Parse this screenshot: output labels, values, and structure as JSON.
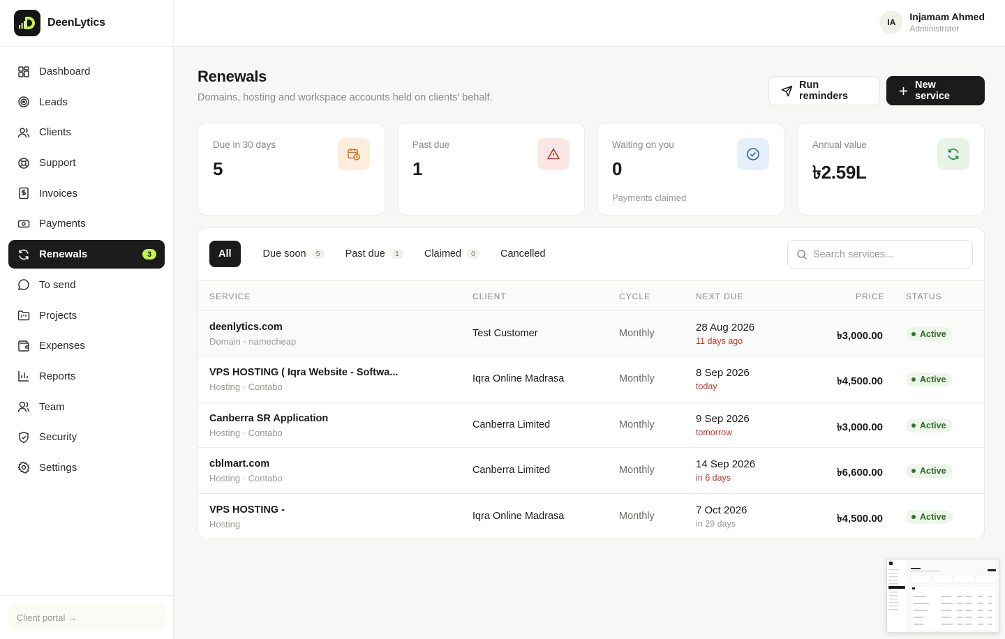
{
  "brand": {
    "name": "DeenLytics"
  },
  "sidebar": {
    "items": [
      {
        "label": "Dashboard",
        "icon": "dashboard-icon"
      },
      {
        "label": "Leads",
        "icon": "target-icon"
      },
      {
        "label": "Clients",
        "icon": "users-icon"
      },
      {
        "label": "Support",
        "icon": "lifebuoy-icon"
      },
      {
        "label": "Invoices",
        "icon": "invoice-icon"
      },
      {
        "label": "Payments",
        "icon": "banknote-icon"
      },
      {
        "label": "Renewals",
        "icon": "refresh-icon",
        "badge": "3",
        "active": true
      },
      {
        "label": "To send",
        "icon": "message-icon"
      },
      {
        "label": "Projects",
        "icon": "folder-icon"
      },
      {
        "label": "Expenses",
        "icon": "wallet-icon"
      },
      {
        "label": "Reports",
        "icon": "bar-chart-icon"
      },
      {
        "label": "Team",
        "icon": "team-icon"
      },
      {
        "label": "Security",
        "icon": "shield-icon"
      },
      {
        "label": "Settings",
        "icon": "gear-icon"
      }
    ],
    "footer_label": "Client portal →"
  },
  "user": {
    "initials": "IA",
    "name": "Injamam Ahmed",
    "role": "Administrator"
  },
  "page": {
    "title": "Renewals",
    "subtitle": "Domains, hosting and workspace accounts held on clients' behalf.",
    "run_reminders": "Run reminders",
    "new_service": "New service"
  },
  "stats": [
    {
      "label": "Due in 30 days",
      "value": "5",
      "sub": "",
      "icon": "calendar-clock-icon",
      "color": "#fbeedd"
    },
    {
      "label": "Past due",
      "value": "1",
      "sub": "",
      "icon": "warning-icon",
      "color": "#fbe6e6"
    },
    {
      "label": "Waiting on you",
      "value": "0",
      "sub": "Payments claimed",
      "icon": "check-circle-icon",
      "color": "#e6f0fa"
    },
    {
      "label": "Annual value",
      "value": "৳2.59L",
      "sub": "",
      "icon": "refresh-icon",
      "color": "#e8f4ea"
    }
  ],
  "tabs": [
    {
      "label": "All",
      "count": ""
    },
    {
      "label": "Due soon",
      "count": "5"
    },
    {
      "label": "Past due",
      "count": "1"
    },
    {
      "label": "Claimed",
      "count": "0"
    },
    {
      "label": "Cancelled",
      "count": ""
    }
  ],
  "search": {
    "placeholder": "Search services..."
  },
  "table": {
    "headers": {
      "service": "SERVICE",
      "client": "CLIENT",
      "cycle": "CYCLE",
      "next_due": "NEXT DUE",
      "price": "PRICE",
      "status": "STATUS"
    },
    "rows": [
      {
        "service": "deenlytics.com",
        "detail": "Domain · namecheap",
        "client": "Test Customer",
        "cycle": "Monthly",
        "date": "28 Aug 2026",
        "relative": "11 days ago",
        "rel_tone": "red",
        "price": "৳3,000.00",
        "status": "Active"
      },
      {
        "service": "VPS HOSTING ( Iqra Website - Softwa...",
        "detail": "Hosting · Contabo",
        "client": "Iqra Online Madrasa",
        "cycle": "Monthly",
        "date": "8 Sep 2026",
        "relative": "today",
        "rel_tone": "red",
        "price": "৳4,500.00",
        "status": "Active"
      },
      {
        "service": "Canberra SR Application",
        "detail": "Hosting · Contabo",
        "client": "Canberra Limited",
        "cycle": "Monthly",
        "date": "9 Sep 2026",
        "relative": "tomorrow",
        "rel_tone": "red",
        "price": "৳3,000.00",
        "status": "Active"
      },
      {
        "service": "cblmart.com",
        "detail": "Hosting · Contabo",
        "client": "Canberra Limited",
        "cycle": "Monthly",
        "date": "14 Sep 2026",
        "relative": "in 6 days",
        "rel_tone": "red",
        "price": "৳6,600.00",
        "status": "Active"
      },
      {
        "service": "VPS HOSTING -",
        "detail": "Hosting",
        "client": "Iqra Online Madrasa",
        "cycle": "Monthly",
        "date": "7 Oct 2026",
        "relative": "in 29 days",
        "rel_tone": "grey",
        "price": "৳4,500.00",
        "status": "Active"
      }
    ]
  }
}
